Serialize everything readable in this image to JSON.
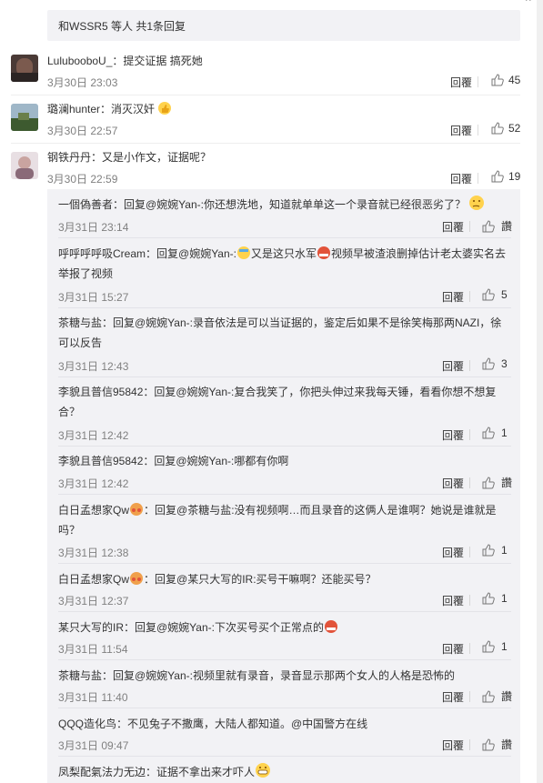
{
  "thread_header": "和WSSR5 等人 共1条回复",
  "top_arrow": "^",
  "reply_label": "回覆",
  "comments": [
    {
      "user": "LulubooboU_",
      "text": "：提交证据 搞死她",
      "time": "3月30日 23:03",
      "likes": "45"
    },
    {
      "user": "璐澜hunter",
      "text": "：消灭汉奸",
      "emoji": "thumbs-up-icon",
      "time": "3月30日 22:57",
      "likes": "52"
    },
    {
      "user": "钢铁丹丹",
      "text": "：又是小作文，证据呢？",
      "time": "3月30日 22:59",
      "likes": "19"
    }
  ],
  "replies": [
    {
      "text": "一個偽善者：回复@婉婉Yan-:你还想洗地，知道就单单这一个录音就已经很恶劣了？",
      "emoji": "thinking-face-icon",
      "time": "3月31日 23:14",
      "likes": "讚"
    },
    {
      "text_a": "呼呼呼呼吸Cream：回复@婉婉Yan-:",
      "text_b": "又是这只水军",
      "text_c": "视频早被渣浪删掉估计老太婆实名去举报了视频",
      "time": "3月31日 15:27",
      "likes": "5"
    },
    {
      "text": "茶糖与盐：回复@婉婉Yan-:录音依法是可以当证据的，鉴定后如果不是徐笑梅那两NAZI，徐可以反告",
      "time": "3月31日 12:43",
      "likes": "3"
    },
    {
      "text": "李貌且普信95842：回复@婉婉Yan-:复合我笑了，你把头伸过来我每天锤，看看你想不想复合？",
      "time": "3月31日 12:42",
      "likes": "1"
    },
    {
      "text": "李貌且普信95842：回复@婉婉Yan-:哪都有你啊",
      "time": "3月31日 12:42",
      "likes": "讚"
    },
    {
      "text_a": "白日孟想家Qw",
      "text_b": "：回复@茶糖与盐:没有视频啊…而且录音的这俩人是谁啊？她说是谁就是吗？",
      "time": "3月31日 12:38",
      "likes": "1"
    },
    {
      "text_a": "白日孟想家Qw",
      "text_b": "：回复@某只大写的IR:买号干嘛啊？还能买号？",
      "time": "3月31日 12:37",
      "likes": "1"
    },
    {
      "text": "某只大写的IR：回复@婉婉Yan-:下次买号买个正常点的",
      "time": "3月31日 11:54",
      "likes": "1"
    },
    {
      "text": "茶糖与盐：回复@婉婉Yan-:视频里就有录音，录音显示那两个女人的人格是恐怖的",
      "time": "3月31日 11:40",
      "likes": "讚"
    },
    {
      "text": "QQQ造化鸟：不见兔子不撒鹰，大陆人都知道。@中国警方在线",
      "time": "3月31日 09:47",
      "likes": "讚"
    },
    {
      "text": "凤梨配氣法力无边：证据不拿出来才吓人"
    }
  ]
}
